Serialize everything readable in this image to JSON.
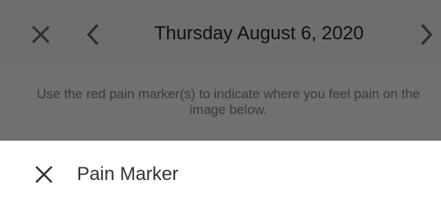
{
  "header": {
    "date_title": "Thursday August 6, 2020",
    "close_icon": "close-icon",
    "prev_icon": "chevron-left-icon",
    "next_icon": "chevron-right-icon"
  },
  "instruction": {
    "text": "Use the red pain marker(s) to indicate where you feel pain on the image below."
  },
  "sheet": {
    "title": "Pain Marker",
    "close_icon": "close-icon"
  },
  "colors": {
    "overlay_gray": "#6f6f6f",
    "sheet_background": "#ffffff",
    "title_text": "#111111",
    "instruction_text": "#3a3a3a",
    "icon_dark": "#333333"
  }
}
